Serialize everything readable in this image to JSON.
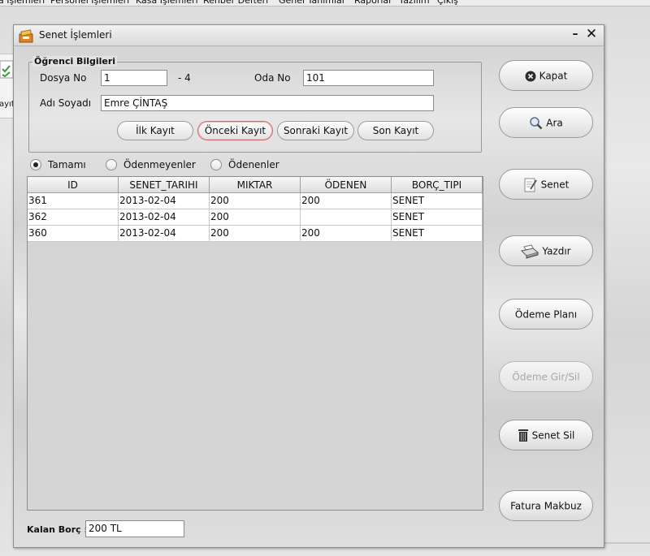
{
  "menubar": [
    "a İşlemleri",
    "Personel İşlemleri",
    "Kasa İşlemleri",
    "Rehber Defteri",
    "Genel Tanımlar",
    "Raporlar",
    "Yazılım",
    "Çıkış"
  ],
  "background": {
    "partial_label": "ayıt"
  },
  "window": {
    "title": "Senet İşlemleri",
    "minimize": "–",
    "close": "✕"
  },
  "student": {
    "group_title": "Öğrenci Bilgileri",
    "dosya_label": "Dosya No",
    "dosya_value": "1",
    "dosya_suffix": "- 4",
    "oda_label": "Oda No",
    "oda_value": "101",
    "ad_label": "Adı Soyadı",
    "ad_value": "Emre ÇİNTAŞ"
  },
  "nav": {
    "first": "İlk Kayıt",
    "prev": "Önceki Kayıt",
    "next": "Sonraki Kayıt",
    "last": "Son Kayıt"
  },
  "filters": {
    "all": "Tamamı",
    "unpaid": "Ödenmeyenler",
    "paid": "Ödenenler",
    "selected": "all"
  },
  "table": {
    "columns": [
      "ID",
      "SENET_TARIHI",
      "MIKTAR",
      "ÖDENEN",
      "BORÇ_TIPI"
    ],
    "rows": [
      [
        "361",
        "2013-02-04",
        "200",
        "200",
        "SENET"
      ],
      [
        "362",
        "2013-02-04",
        "200",
        "",
        "SENET"
      ],
      [
        "360",
        "2013-02-04",
        "200",
        "200",
        "SENET"
      ]
    ]
  },
  "side_buttons": {
    "kapat": "Kapat",
    "ara": "Ara",
    "senet": "Senet",
    "yazdir": "Yazdır",
    "odeme_plani": "Ödeme Planı",
    "odeme_gir_sil": "Ödeme Gir/Sil",
    "senet_sil": "Senet Sil",
    "fatura_makbuz": "Fatura Makbuz"
  },
  "balance": {
    "label": "Kalan Borç :",
    "value": "200 TL"
  },
  "colors": {
    "focus_border": "#d06a6a",
    "disabled_text": "#a8a8a8"
  }
}
